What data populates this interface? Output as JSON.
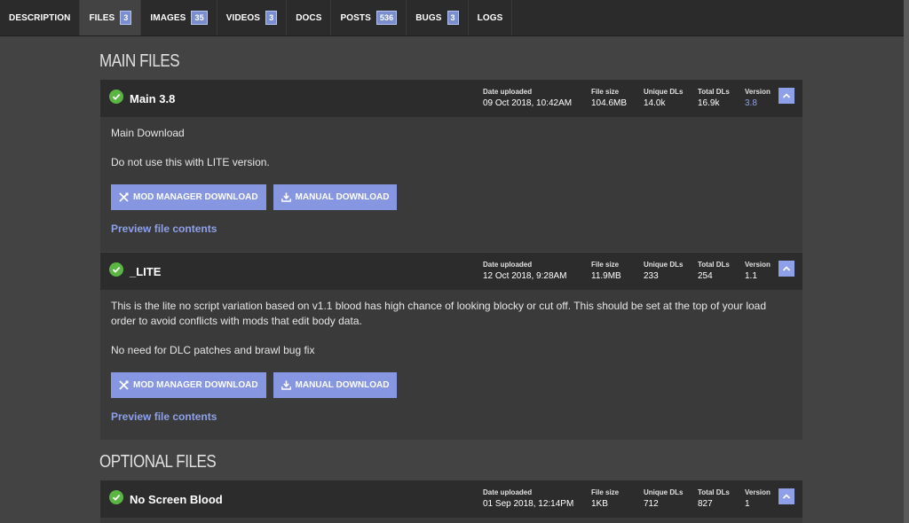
{
  "tabs": [
    {
      "label": "DESCRIPTION",
      "badge": ""
    },
    {
      "label": "FILES",
      "badge": "3"
    },
    {
      "label": "IMAGES",
      "badge": "35"
    },
    {
      "label": "VIDEOS",
      "badge": "3"
    },
    {
      "label": "DOCS",
      "badge": ""
    },
    {
      "label": "POSTS",
      "badge": "536"
    },
    {
      "label": "BUGS",
      "badge": "3"
    },
    {
      "label": "LOGS",
      "badge": ""
    }
  ],
  "active_tab": "FILES",
  "sections": {
    "main_title": "MAIN FILES",
    "optional_title": "OPTIONAL FILES"
  },
  "meta_labels": {
    "date": "Date uploaded",
    "size": "File size",
    "unique": "Unique DLs",
    "total": "Total DLs",
    "version": "Version"
  },
  "files": [
    {
      "name": "Main 3.8",
      "date": "09 Oct 2018, 10:42AM",
      "size": "104.6MB",
      "unique": "14.0k",
      "total": "16.9k",
      "version": "3.8",
      "desc": [
        "Main Download",
        "Do not use this with LITE version."
      ]
    },
    {
      "name": "_LITE",
      "date": "12 Oct 2018, 9:28AM",
      "size": "11.9MB",
      "unique": "233",
      "total": "254",
      "version": "1.1",
      "desc": [
        "This is the lite no script variation based on v1.1 blood has high chance of looking blocky or cut off. This should be set at the top of your load order to avoid conflicts with mods that edit body data.",
        "No need for DLC patches and brawl bug fix"
      ]
    },
    {
      "name": "No Screen Blood",
      "date": "01 Sep 2018, 12:14PM",
      "size": "1KB",
      "unique": "712",
      "total": "827",
      "version": "1"
    }
  ],
  "buttons": {
    "mod_manager": "MOD MANAGER DOWNLOAD",
    "manual": "MANUAL DOWNLOAD",
    "preview": "Preview file contents"
  },
  "icons": {
    "check": "check-circle-icon",
    "collapse": "chevron-up-icon",
    "mod_manager": "tools-icon",
    "manual": "download-icon"
  },
  "colors": {
    "accent": "#8696e0",
    "success": "#5ab543",
    "background": "#434343"
  }
}
